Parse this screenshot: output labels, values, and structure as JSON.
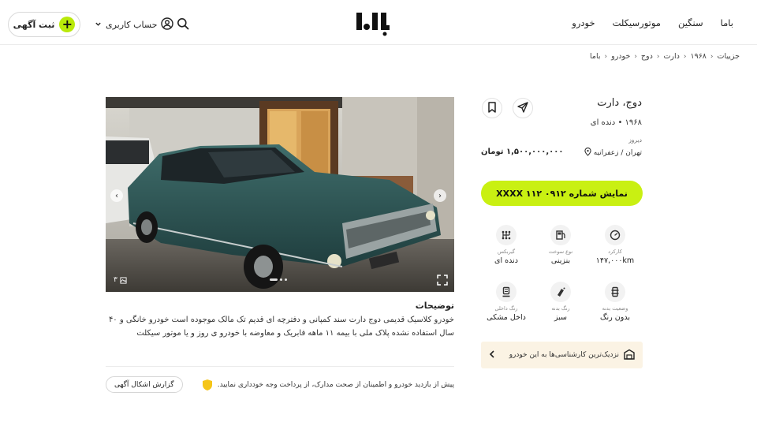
{
  "header": {
    "post_label": "ثبت آگهی",
    "account_label": "حساب کاربری",
    "nav": [
      "خودرو",
      "موتورسیکلت",
      "سنگین",
      "باما"
    ]
  },
  "breadcrumb": [
    "باما",
    "خودرو",
    "دوج",
    "دارت",
    "۱۹۶۸",
    "جزییات"
  ],
  "listing": {
    "title": "دوج، دارت",
    "subtitle": "۱۹۶۸ • دنده ای",
    "posted": "دیروز",
    "location": "تهران / زعفرانیه",
    "price": "۱,۵۰۰,۰۰۰,۰۰۰ تومان",
    "call_button": "نمایش شماره  ۰۹۱۲ ۱۱۲ XXXX",
    "photo_count": "۳"
  },
  "specs": [
    {
      "icon": "speedometer-icon",
      "label": "کارکرد",
      "value": "۱۴۷,۰۰۰km"
    },
    {
      "icon": "fuel-icon",
      "label": "نوع سوخت",
      "value": "بنزینی"
    },
    {
      "icon": "gearbox-icon",
      "label": "گیربکس",
      "value": "دنده ای"
    },
    {
      "icon": "paint-condition-icon",
      "label": "وضعیت بدنه",
      "value": "بدون رنگ"
    },
    {
      "icon": "spray-paint-icon",
      "label": "رنگ بدنه",
      "value": "سبز"
    },
    {
      "icon": "car-seat-icon",
      "label": "رنگ داخلی",
      "value": "داخل مشکی"
    }
  ],
  "description": {
    "title": "توضیحات",
    "text": "خودرو کلاسیک قدیمی دوج دارت سند کمپانی و دفترچه ای قدیم تک مالک موجوده  است خودرو خانگی و ۴۰ سال استفاده نشده پلاک ملی با بیمه ۱۱ ماهه فابریک و معاوضه با خودرو ی روز و یا موتور سیکلت"
  },
  "warning": "پیش از بازدید خودرو و اطمینان از صحت مدارک، از پرداخت وجه خودداری نمایید.",
  "report_label": "گزارش اشکال آگهی",
  "experts_label": "نزدیک‌ترین کارشناسی‌ها به این خودرو",
  "colors": {
    "accent": "#c9f012",
    "plus": "#b9e90a",
    "experts_bg": "#fbf3e4",
    "warn_badge": "#f5c518"
  }
}
